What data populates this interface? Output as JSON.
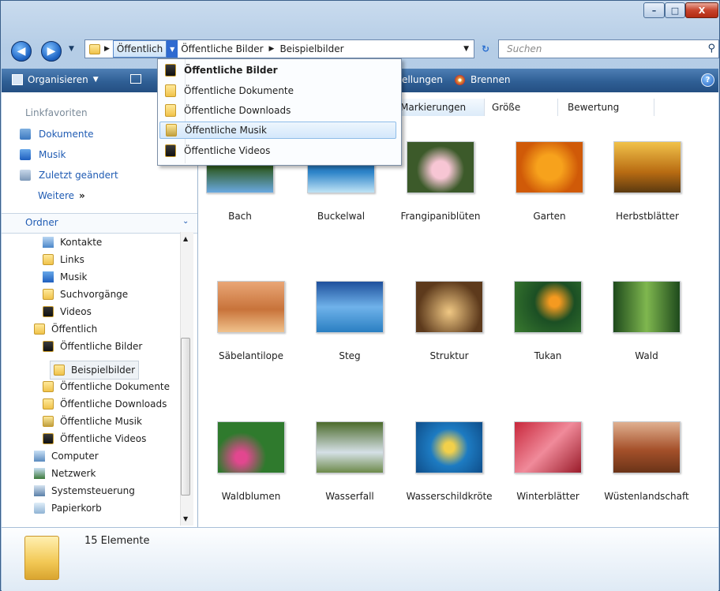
{
  "window": {
    "minimize_label": "–",
    "maximize_label": "□",
    "close_label": "X"
  },
  "address": {
    "segments": [
      "Öffentlich",
      "Öffentliche Bilder",
      "Beispielbilder"
    ],
    "search_placeholder": "Suchen"
  },
  "toolbar": {
    "organize": "Organisieren",
    "settings_partial": "ellungen",
    "burn": "Brennen"
  },
  "favorites": {
    "title": "Linkfavoriten",
    "items": [
      "Dokumente",
      "Musik",
      "Zuletzt geändert"
    ],
    "more": "Weitere"
  },
  "folders": {
    "title": "Ordner",
    "items": [
      "Kontakte",
      "Links",
      "Musik",
      "Suchvorgänge",
      "Videos",
      "Öffentlich",
      "Öffentliche Bilder",
      "Beispielbilder",
      "Öffentliche Dokumente",
      "Öffentliche Downloads",
      "Öffentliche Musik",
      "Öffentliche Videos",
      "Computer",
      "Netzwerk",
      "Systemsteuerung",
      "Papierkorb"
    ]
  },
  "columns": [
    "Markierungen",
    "Größe",
    "Bewertung"
  ],
  "photos": [
    "Bach",
    "Buckelwal",
    "Frangipaniblüten",
    "Garten",
    "Herbstblätter",
    "Säbelantilope",
    "Steg",
    "Struktur",
    "Tukan",
    "Wald",
    "Waldblumen",
    "Wasserfall",
    "Wasserschildkröte",
    "Winterblätter",
    "Wüstenlandschaft"
  ],
  "dropdown": {
    "items": [
      "Öffentliche Bilder",
      "Öffentliche Dokumente",
      "Öffentliche Downloads",
      "Öffentliche Musik",
      "Öffentliche Videos"
    ],
    "bold_item": "Öffentliche Bilder",
    "highlighted_item": "Öffentliche Musik"
  },
  "details": {
    "count": "15 Elemente"
  }
}
